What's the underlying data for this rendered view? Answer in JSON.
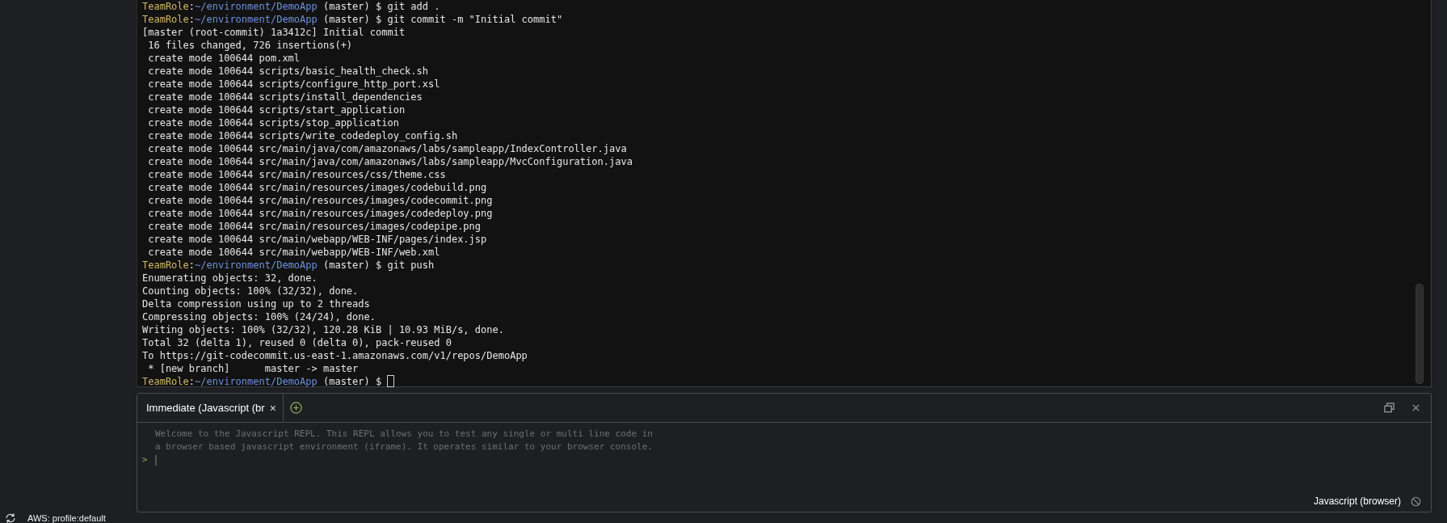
{
  "terminal": {
    "lines": [
      {
        "kind": "prompt",
        "user": "TeamRole",
        "path": "~/environment/DemoApp",
        "sep": ":",
        "rest": " (master) $ git add .",
        "cursor": false
      },
      {
        "kind": "prompt",
        "user": "TeamRole",
        "path": "~/environment/DemoApp",
        "sep": ":",
        "rest": " (master) $ git commit -m \"Initial commit\"",
        "cursor": false
      },
      {
        "kind": "output",
        "text": "[master (root-commit) 1a3412c] Initial commit"
      },
      {
        "kind": "output",
        "text": " 16 files changed, 726 insertions(+)"
      },
      {
        "kind": "output",
        "text": " create mode 100644 pom.xml"
      },
      {
        "kind": "output",
        "text": " create mode 100644 scripts/basic_health_check.sh"
      },
      {
        "kind": "output",
        "text": " create mode 100644 scripts/configure_http_port.xsl"
      },
      {
        "kind": "output",
        "text": " create mode 100644 scripts/install_dependencies"
      },
      {
        "kind": "output",
        "text": " create mode 100644 scripts/start_application"
      },
      {
        "kind": "output",
        "text": " create mode 100644 scripts/stop_application"
      },
      {
        "kind": "output",
        "text": " create mode 100644 scripts/write_codedeploy_config.sh"
      },
      {
        "kind": "output",
        "text": " create mode 100644 src/main/java/com/amazonaws/labs/sampleapp/IndexController.java"
      },
      {
        "kind": "output",
        "text": " create mode 100644 src/main/java/com/amazonaws/labs/sampleapp/MvcConfiguration.java"
      },
      {
        "kind": "output",
        "text": " create mode 100644 src/main/resources/css/theme.css"
      },
      {
        "kind": "output",
        "text": " create mode 100644 src/main/resources/images/codebuild.png"
      },
      {
        "kind": "output",
        "text": " create mode 100644 src/main/resources/images/codecommit.png"
      },
      {
        "kind": "output",
        "text": " create mode 100644 src/main/resources/images/codedeploy.png"
      },
      {
        "kind": "output",
        "text": " create mode 100644 src/main/resources/images/codepipe.png"
      },
      {
        "kind": "output",
        "text": " create mode 100644 src/main/webapp/WEB-INF/pages/index.jsp"
      },
      {
        "kind": "output",
        "text": " create mode 100644 src/main/webapp/WEB-INF/web.xml"
      },
      {
        "kind": "prompt",
        "user": "TeamRole",
        "path": "~/environment/DemoApp",
        "sep": ":",
        "rest": " (master) $ git push",
        "cursor": false
      },
      {
        "kind": "output",
        "text": "Enumerating objects: 32, done."
      },
      {
        "kind": "output",
        "text": "Counting objects: 100% (32/32), done."
      },
      {
        "kind": "output",
        "text": "Delta compression using up to 2 threads"
      },
      {
        "kind": "output",
        "text": "Compressing objects: 100% (24/24), done."
      },
      {
        "kind": "output",
        "text": "Writing objects: 100% (32/32), 120.28 KiB | 10.93 MiB/s, done."
      },
      {
        "kind": "output",
        "text": "Total 32 (delta 1), reused 0 (delta 0), pack-reused 0"
      },
      {
        "kind": "output",
        "text": "To https://git-codecommit.us-east-1.amazonaws.com/v1/repos/DemoApp"
      },
      {
        "kind": "output",
        "text": " * [new branch]      master -> master"
      },
      {
        "kind": "prompt",
        "user": "TeamRole",
        "path": "~/environment/DemoApp",
        "sep": ":",
        "rest": " (master) $ ",
        "cursor": true
      }
    ]
  },
  "repl": {
    "tabs": [
      {
        "label": "Immediate (Javascript (br",
        "close": "×",
        "selected": true
      }
    ],
    "welcome": [
      "Welcome to the Javascript REPL. This REPL allows you to test any single or multi line code in",
      "a browser based javascript environment (iframe). It operates similar to your browser console."
    ],
    "prompt": ">",
    "runtime": "Javascript (browser)"
  },
  "status_bar": {
    "text": "AWS: profile:default"
  }
}
